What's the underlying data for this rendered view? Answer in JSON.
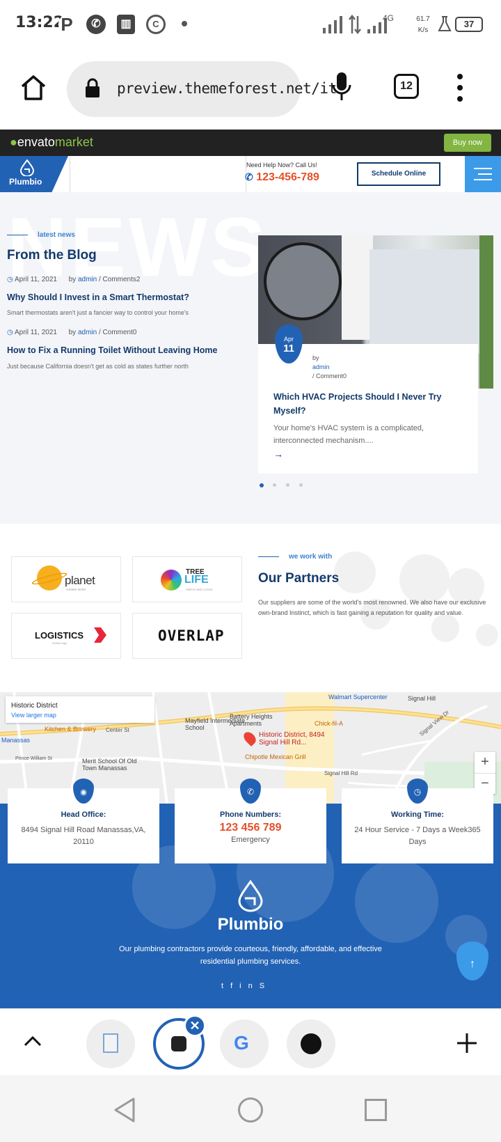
{
  "status_bar": {
    "time": "13:22",
    "net_speed_value": "61.7",
    "net_speed_unit": "K/s",
    "battery": "37",
    "network_type": "4G"
  },
  "browser": {
    "url": "preview.themeforest.net/it",
    "tab_count": "12"
  },
  "envato": {
    "logo_prefix": "envato",
    "logo_suffix": "market",
    "buy_label": "Buy now"
  },
  "site_header": {
    "brand": "Plumbio",
    "help_text": "Need Help Now? Call Us!",
    "phone": "123-456-789",
    "schedule_label": "Schedule Online"
  },
  "blog": {
    "bg_word": "NEWS",
    "eyebrow": "latest news",
    "title": "From the Blog",
    "posts": [
      {
        "date": "April 11, 2021",
        "by": "by",
        "author": "admin",
        "comments": "/ Comments2",
        "title": "Why Should I Invest in a Smart Thermostat?",
        "excerpt": "Smart thermostats aren't just a fancier way to control your home's"
      },
      {
        "date": "April 11, 2021",
        "by": "by",
        "author": "admin",
        "comments": "/ Comment0",
        "title": "How to Fix a Running Toilet Without Leaving Home",
        "excerpt": "Just because California doesn't get as cold as states further north"
      }
    ],
    "featured": {
      "month": "Apr",
      "day": "11",
      "by": "by",
      "author": "admin",
      "comments": "/ Comment0",
      "title": "Which HVAC Projects Should I Never Try Myself?",
      "excerpt": "Your home's HVAC system is a complicated, interconnected mechanism....",
      "arrow": "→"
    }
  },
  "partners": {
    "eyebrow": "we work with",
    "title": "Our Partners",
    "description": "Our suppliers are some of the world's most renowned. We also have our exclusive own-brand Instinct, which is fast gaining a reputation for quality and value.",
    "logos": [
      {
        "name": "planet",
        "tag": "creative world"
      },
      {
        "name": "TREE",
        "name2": "LIFE",
        "tag": "SIMPLE AND CLEAN"
      },
      {
        "name": "LOGISTICS",
        "tag": "Perfect logo"
      },
      {
        "name": "OVERLAP"
      }
    ]
  },
  "map": {
    "place_title": "Historic District",
    "larger_map": "View larger map",
    "pin_label": "Historic District, 8494 Signal Hill Rd...",
    "labels": [
      "Walmart Supercenter",
      "Mayfield Intermediate School",
      "Battery Heights Apartments",
      "Chick-fil-A",
      "Signal Hill",
      "Kitchen & Brewery",
      "Manassas",
      "Merit School Of Old Town Manassas",
      "Chipotle Mexican Grill",
      "Signal Hill Rd",
      "Center St",
      "Prince William St",
      "Signal View Dr",
      "Signal Hill Rd"
    ],
    "zoom_in": "+",
    "zoom_out": "−"
  },
  "contact_cards": [
    {
      "title": "Head Office:",
      "value": "8494 Signal Hill Road Manassas,VA, 20110"
    },
    {
      "title": "Phone Numbers:",
      "value": "123 456 789",
      "sub": "Emergency"
    },
    {
      "title": "Working Time:",
      "value": "24 Hour Service - 7 Days a Week365 Days"
    }
  ],
  "footer": {
    "brand": "Plumbio",
    "description": "Our plumbing contractors provide courteous, friendly, affordable, and effective residential plumbing services.",
    "social": [
      "twitter-icon",
      "facebook-icon",
      "linkedin-icon",
      "skype-icon"
    ],
    "back_to_top": "↑"
  },
  "colors": {
    "brand_blue": "#2262b4",
    "navy": "#123a6b",
    "accent_orange": "#e4502a",
    "envato_green": "#82b541"
  }
}
